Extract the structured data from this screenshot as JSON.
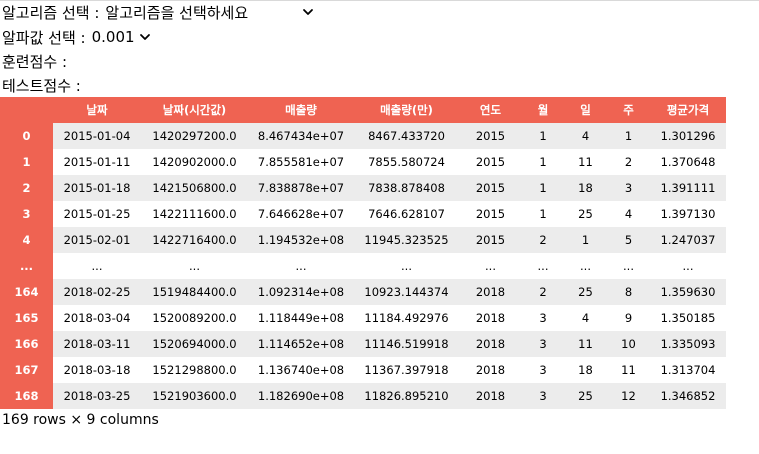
{
  "controls": {
    "algorithm_label": "알고리즘 선택 :",
    "algorithm_value": "알고리즘을 선택하세요",
    "alpha_label": "알파값 선택 :",
    "alpha_value": "0.001"
  },
  "scores": {
    "train_label": "훈련점수 :",
    "test_label": "테스트점수 :"
  },
  "table": {
    "columns": [
      "",
      "날짜",
      "날짜(시간값)",
      "매출량",
      "매출량(만)",
      "연도",
      "월",
      "일",
      "주",
      "평균가격"
    ],
    "rows": [
      {
        "index": "0",
        "cells": [
          "2015-01-04",
          "1420297200.0",
          "8.467434e+07",
          "8467.433720",
          "2015",
          "1",
          "4",
          "1",
          "1.301296"
        ]
      },
      {
        "index": "1",
        "cells": [
          "2015-01-11",
          "1420902000.0",
          "7.855581e+07",
          "7855.580724",
          "2015",
          "1",
          "11",
          "2",
          "1.370648"
        ]
      },
      {
        "index": "2",
        "cells": [
          "2015-01-18",
          "1421506800.0",
          "7.838878e+07",
          "7838.878408",
          "2015",
          "1",
          "18",
          "3",
          "1.391111"
        ]
      },
      {
        "index": "3",
        "cells": [
          "2015-01-25",
          "1422111600.0",
          "7.646628e+07",
          "7646.628107",
          "2015",
          "1",
          "25",
          "4",
          "1.397130"
        ]
      },
      {
        "index": "4",
        "cells": [
          "2015-02-01",
          "1422716400.0",
          "1.194532e+08",
          "11945.323525",
          "2015",
          "2",
          "1",
          "5",
          "1.247037"
        ]
      },
      {
        "index": "...",
        "cells": [
          "...",
          "...",
          "...",
          "...",
          "...",
          "...",
          "...",
          "...",
          "..."
        ]
      },
      {
        "index": "164",
        "cells": [
          "2018-02-25",
          "1519484400.0",
          "1.092314e+08",
          "10923.144374",
          "2018",
          "2",
          "25",
          "8",
          "1.359630"
        ]
      },
      {
        "index": "165",
        "cells": [
          "2018-03-04",
          "1520089200.0",
          "1.118449e+08",
          "11184.492976",
          "2018",
          "3",
          "4",
          "9",
          "1.350185"
        ]
      },
      {
        "index": "166",
        "cells": [
          "2018-03-11",
          "1520694000.0",
          "1.114652e+08",
          "11146.519918",
          "2018",
          "3",
          "11",
          "10",
          "1.335093"
        ]
      },
      {
        "index": "167",
        "cells": [
          "2018-03-18",
          "1521298800.0",
          "1.136740e+08",
          "11367.397918",
          "2018",
          "3",
          "18",
          "11",
          "1.313704"
        ]
      },
      {
        "index": "168",
        "cells": [
          "2018-03-25",
          "1521903600.0",
          "1.182690e+08",
          "11826.895210",
          "2018",
          "3",
          "25",
          "12",
          "1.346852"
        ]
      }
    ]
  },
  "footer": "169 rows × 9 columns",
  "colors": {
    "header_bg": "#ef6352",
    "header_text": "#ffffff",
    "row_alt": "#ececec"
  },
  "icons": {
    "dropdown": "chevron-down-icon"
  }
}
